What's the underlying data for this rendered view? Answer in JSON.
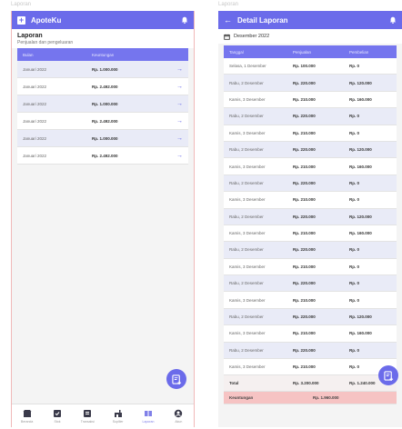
{
  "left_frame_label": "Laporan",
  "right_frame_label": "Laporan",
  "left": {
    "app_title": "ApoteKu",
    "section_title": "Laporan",
    "section_subtitle": "Penjualan dan pengeluaran",
    "columns": [
      "Bulan",
      "Keuntungan"
    ],
    "rows": [
      {
        "bulan": "Januari 2022",
        "keuntungan": "Rp. 1.000.000"
      },
      {
        "bulan": "Januari 2022",
        "keuntungan": "Rp. 2.492.000"
      },
      {
        "bulan": "Januari 2022",
        "keuntungan": "Rp. 1.000.000"
      },
      {
        "bulan": "Januari 2022",
        "keuntungan": "Rp. 2.492.000"
      },
      {
        "bulan": "Januari 2022",
        "keuntungan": "Rp. 1.000.000"
      },
      {
        "bulan": "Januari 2022",
        "keuntungan": "Rp. 2.492.000"
      }
    ],
    "nav": [
      {
        "label": "Beranda",
        "icon": "store-icon"
      },
      {
        "label": "Stok",
        "icon": "check-box-icon"
      },
      {
        "label": "Transaksi",
        "icon": "receipt-icon"
      },
      {
        "label": "Supllier",
        "icon": "delivery-icon"
      },
      {
        "label": "Laporan",
        "icon": "book-icon",
        "active": true
      },
      {
        "label": "Akun",
        "icon": "account-icon"
      }
    ]
  },
  "right": {
    "app_title": "Detail Laporan",
    "period": "Desember 2022",
    "columns": [
      "Tanggal",
      "Penjualan",
      "Pembelian"
    ],
    "rows": [
      {
        "tanggal": "Selasa, 1 Desember",
        "penjualan": "Rp. 100.000",
        "pembelian": "Rp. 0"
      },
      {
        "tanggal": "Rabu, 2 Desember",
        "penjualan": "Rp. 220.000",
        "pembelian": "Rp. 120.000"
      },
      {
        "tanggal": "Kamis, 3 Desember",
        "penjualan": "Rp. 210.000",
        "pembelian": "Rp. 160.000"
      },
      {
        "tanggal": "Rabu, 2 Desember",
        "penjualan": "Rp. 220.000",
        "pembelian": "Rp. 0"
      },
      {
        "tanggal": "Kamis, 3 Desember",
        "penjualan": "Rp. 210.000",
        "pembelian": "Rp. 0"
      },
      {
        "tanggal": "Rabu, 2 Desember",
        "penjualan": "Rp. 220.000",
        "pembelian": "Rp. 120.000"
      },
      {
        "tanggal": "Kamis, 3 Desember",
        "penjualan": "Rp. 210.000",
        "pembelian": "Rp. 160.000"
      },
      {
        "tanggal": "Rabu, 2 Desember",
        "penjualan": "Rp. 220.000",
        "pembelian": "Rp. 0"
      },
      {
        "tanggal": "Kamis, 3 Desember",
        "penjualan": "Rp. 210.000",
        "pembelian": "Rp. 0"
      },
      {
        "tanggal": "Rabu, 2 Desember",
        "penjualan": "Rp. 220.000",
        "pembelian": "Rp. 120.000"
      },
      {
        "tanggal": "Kamis, 3 Desember",
        "penjualan": "Rp. 210.000",
        "pembelian": "Rp. 160.000"
      },
      {
        "tanggal": "Rabu, 2 Desember",
        "penjualan": "Rp. 220.000",
        "pembelian": "Rp. 0"
      },
      {
        "tanggal": "Kamis, 3 Desember",
        "penjualan": "Rp. 210.000",
        "pembelian": "Rp. 0"
      },
      {
        "tanggal": "Rabu, 2 Desember",
        "penjualan": "Rp. 220.000",
        "pembelian": "Rp. 0"
      },
      {
        "tanggal": "Kamis, 3 Desember",
        "penjualan": "Rp. 210.000",
        "pembelian": "Rp. 0"
      },
      {
        "tanggal": "Rabu, 2 Desember",
        "penjualan": "Rp. 220.000",
        "pembelian": "Rp. 120.000"
      },
      {
        "tanggal": "Kamis, 3 Desember",
        "penjualan": "Rp. 210.000",
        "pembelian": "Rp. 160.000"
      },
      {
        "tanggal": "Rabu, 2 Desember",
        "penjualan": "Rp. 220.000",
        "pembelian": "Rp. 0"
      },
      {
        "tanggal": "Kamis, 3 Desember",
        "penjualan": "Rp. 210.000",
        "pembelian": "Rp. 0"
      }
    ],
    "total_label": "Total",
    "total_penjualan": "Rp. 3.200.000",
    "total_pembelian": "Rp. 1.240.000",
    "balance_label": "Keuntungan",
    "balance_value": "Rp. 1.960.000"
  },
  "colors": {
    "primary": "#6b6bea",
    "table_header": "#7575ee",
    "row_alt": "#e9ebf7",
    "balance": "#f6c3c3"
  }
}
